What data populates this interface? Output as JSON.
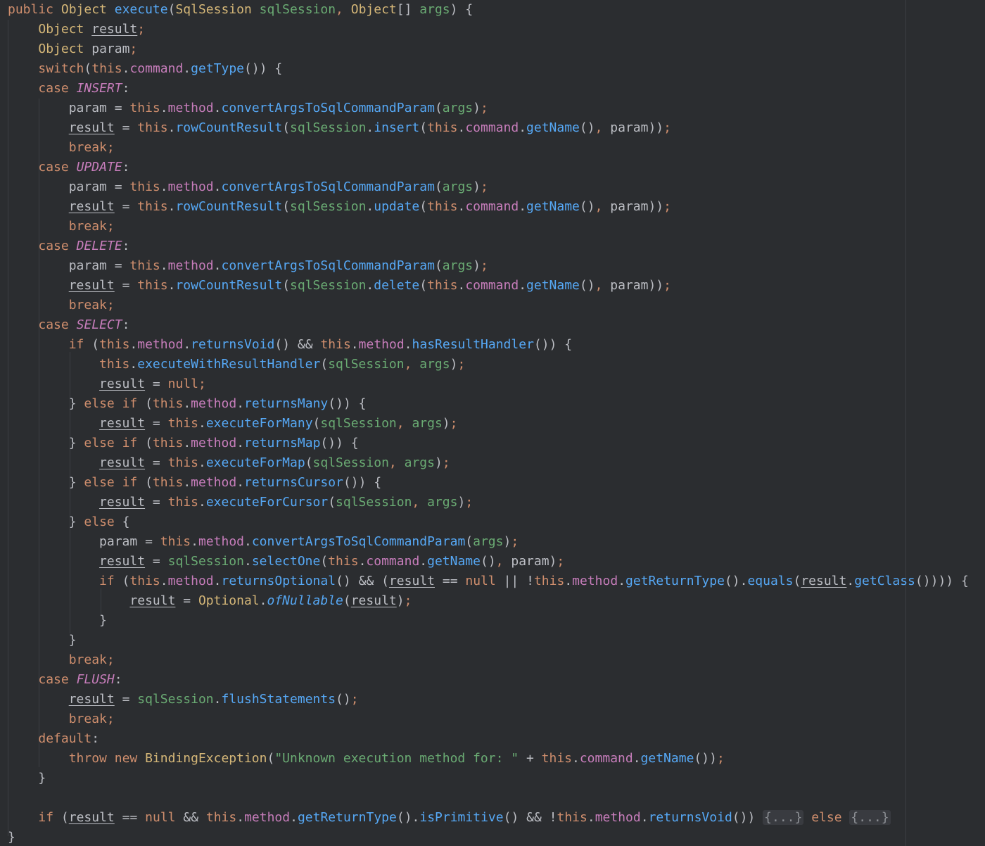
{
  "editor": {
    "language": "java",
    "theme_background": "#2b2d30",
    "colors": {
      "keyword": "#cf8e6d",
      "type": "#d5b778",
      "method": "#56a8f5",
      "field": "#c77dbb",
      "parameter": "#6aab73",
      "text": "#bcbec4"
    },
    "lines": [
      "public Object execute(SqlSession sqlSession, Object[] args) {",
      "    Object result;",
      "    Object param;",
      "    switch(this.command.getType()) {",
      "    case INSERT:",
      "        param = this.method.convertArgsToSqlCommandParam(args);",
      "        result = this.rowCountResult(sqlSession.insert(this.command.getName(), param));",
      "        break;",
      "    case UPDATE:",
      "        param = this.method.convertArgsToSqlCommandParam(args);",
      "        result = this.rowCountResult(sqlSession.update(this.command.getName(), param));",
      "        break;",
      "    case DELETE:",
      "        param = this.method.convertArgsToSqlCommandParam(args);",
      "        result = this.rowCountResult(sqlSession.delete(this.command.getName(), param));",
      "        break;",
      "    case SELECT:",
      "        if (this.method.returnsVoid() && this.method.hasResultHandler()) {",
      "            this.executeWithResultHandler(sqlSession, args);",
      "            result = null;",
      "        } else if (this.method.returnsMany()) {",
      "            result = this.executeForMany(sqlSession, args);",
      "        } else if (this.method.returnsMap()) {",
      "            result = this.executeForMap(sqlSession, args);",
      "        } else if (this.method.returnsCursor()) {",
      "            result = this.executeForCursor(sqlSession, args);",
      "        } else {",
      "            param = this.method.convertArgsToSqlCommandParam(args);",
      "            result = sqlSession.selectOne(this.command.getName(), param);",
      "            if (this.method.returnsOptional() && (result == null || !this.method.getReturnType().equals(result.getClass()))) {",
      "                result = Optional.ofNullable(result);",
      "            }",
      "        }",
      "        break;",
      "    case FLUSH:",
      "        result = sqlSession.flushStatements();",
      "        break;",
      "    default:",
      "        throw new BindingException(\"Unknown execution method for: \" + this.command.getName());",
      "    }",
      "",
      "    if (result == null && this.method.getReturnType().isPrimitive() && !this.method.returnsVoid()) {...} else {...}",
      "}"
    ],
    "folded_region_label": "{...}"
  }
}
